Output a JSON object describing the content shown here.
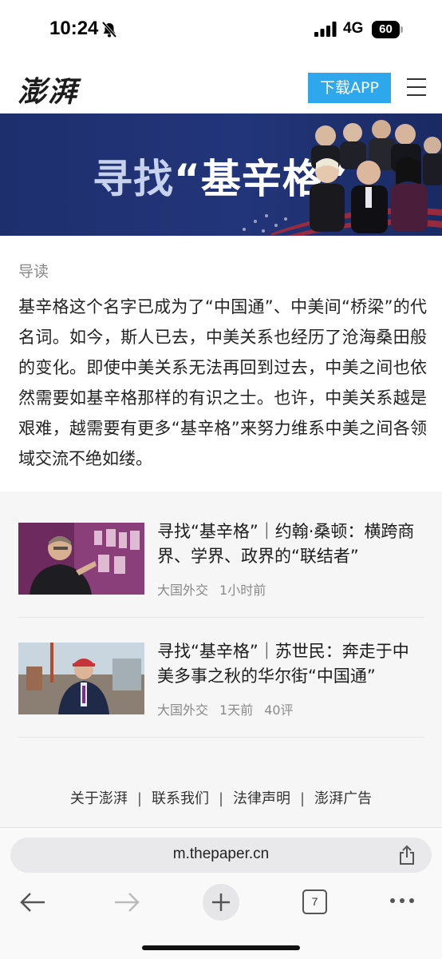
{
  "status_bar": {
    "time": "10:24",
    "network": "4G",
    "battery": "60"
  },
  "header": {
    "logo": "澎湃",
    "download_label": "下载APP"
  },
  "banner": {
    "title_prefix": "寻找",
    "title_main": "“基辛格”"
  },
  "intro": {
    "label": "导读",
    "text": "基辛格这个名字已成为了“中国通”、中美间“桥梁”的代名词。如今，斯人已去，中美关系也经历了沧海桑田般的变化。即使中美关系无法再回到过去，中美之间也依然需要如基辛格那样的有识之士。也许，中美关系越是艰难，越需要有更多“基辛格”来努力维系中美之间各领域交流不绝如缕。"
  },
  "articles": [
    {
      "title": "寻找“基辛格”｜约翰·桑顿：横跨商界、学界、政界的“联结者”",
      "category": "大国外交",
      "time": "1小时前",
      "comments": ""
    },
    {
      "title": "寻找“基辛格”｜苏世民：奔走于中美多事之秋的华尔街“中国通”",
      "category": "大国外交",
      "time": "1天前",
      "comments": "40评"
    }
  ],
  "footer": {
    "links": [
      "关于澎湃",
      "联系我们",
      "法律声明",
      "澎湃广告"
    ],
    "separator": "|"
  },
  "browser": {
    "url": "m.thepaper.cn",
    "tab_count": "7"
  },
  "colors": {
    "accent": "#2fa7ec",
    "banner_bg": "#23357a"
  }
}
